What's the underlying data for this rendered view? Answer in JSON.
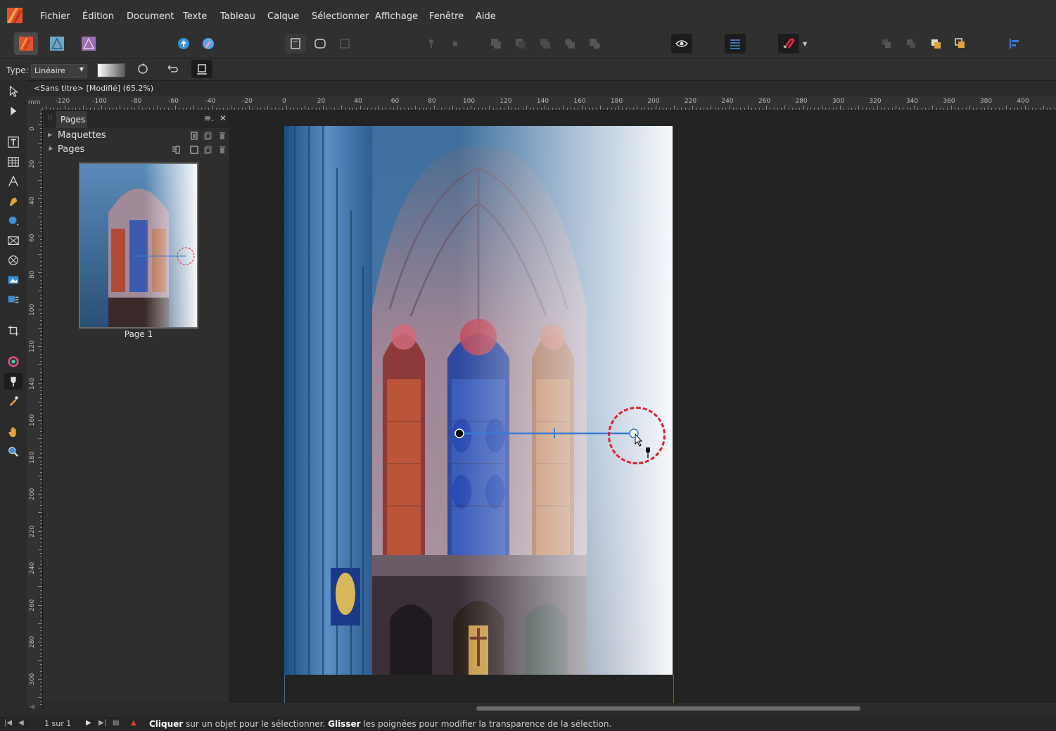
{
  "menu": {
    "items": [
      "Fichier",
      "Édition",
      "Document",
      "Texte",
      "Tableau",
      "Calque",
      "Sélectionner",
      "Affichage",
      "Fenêtre",
      "Aide"
    ]
  },
  "context_toolbar": {
    "type_label": "Type:",
    "type_value": "Linéaire"
  },
  "document": {
    "tab_title": "<Sans titre> [Modifié] (65.2%)"
  },
  "ruler": {
    "unit": "mm",
    "h_labels": [
      "-120",
      "-100",
      "-80",
      "-60",
      "-40",
      "-20",
      "0",
      "20",
      "40",
      "60",
      "80",
      "100",
      "120",
      "140",
      "160",
      "180",
      "200",
      "220",
      "240",
      "260",
      "280",
      "300",
      "320",
      "340",
      "360",
      "380",
      "400"
    ],
    "v_labels": [
      "0",
      "20",
      "40",
      "60",
      "80",
      "100",
      "120",
      "140",
      "160",
      "180",
      "200",
      "220",
      "240",
      "260",
      "280",
      "300"
    ]
  },
  "pages_panel": {
    "tab_label": "Pages",
    "sections": [
      {
        "label": "Maquettes",
        "expanded": false
      },
      {
        "label": "Pages",
        "expanded": true
      }
    ],
    "thumbnail_label": "Page 1"
  },
  "status": {
    "page_counter": "1 sur 1",
    "text_bold_1": "Cliquer",
    "text_1": " sur un objet pour le sélectionner. ",
    "text_bold_2": "Glisser",
    "text_2": " les poignées pour modifier la transparence de la sélection."
  },
  "icons": {
    "app_logo": "affinity-publisher-logo",
    "personas": [
      "publisher-persona-icon",
      "designer-persona-icon",
      "photo-persona-icon"
    ],
    "active_tool": "transparency-tool-icon"
  },
  "colors": {
    "accent": "#3a7bd5",
    "highlight_circle": "#e0202a"
  }
}
